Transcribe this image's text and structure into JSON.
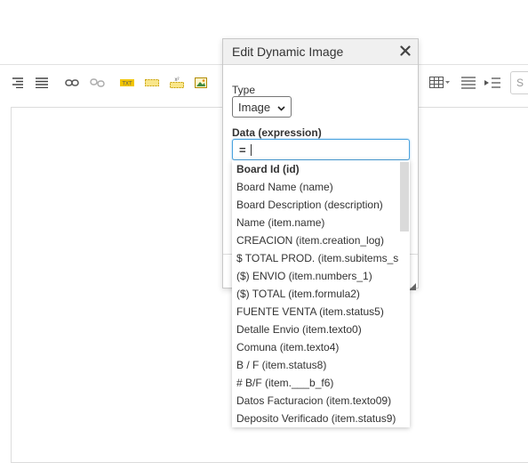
{
  "toolbar": {
    "icons": [
      "align-right-icon",
      "justify-icon",
      "link-icon",
      "unlink-icon",
      "text-field-icon",
      "dashed-field-icon",
      "dynamic-field-icon",
      "image-icon",
      "table-icon",
      "horizontal-rule-icon",
      "indent-icon",
      "preview-icon"
    ],
    "search_placeholder": "S",
    "accent_yellow": "#f2c500"
  },
  "dialog": {
    "title": "Edit Dynamic Image",
    "close_symbol": "✕",
    "type_label": "Type",
    "type_value": "Image",
    "data_label": "Data (expression)",
    "data_value": "= "
  },
  "dropdown": {
    "items": [
      "Board Id (id)",
      "Board Name (name)",
      "Board Description (description)",
      "Name (item.name)",
      "CREACION (item.creation_log)",
      "$ TOTAL PROD. (item.subitems_s",
      "($) ENVIO (item.numbers_1)",
      "($) TOTAL (item.formula2)",
      "FUENTE VENTA (item.status5)",
      "Detalle Envio (item.texto0)",
      "Comuna (item.texto4)",
      "B / F (item.status8)",
      "# B/F (item.___b_f6)",
      "Datos Facturacion (item.texto09)",
      "Deposito Verificado (item.status9)"
    ],
    "selected_index": 0
  }
}
